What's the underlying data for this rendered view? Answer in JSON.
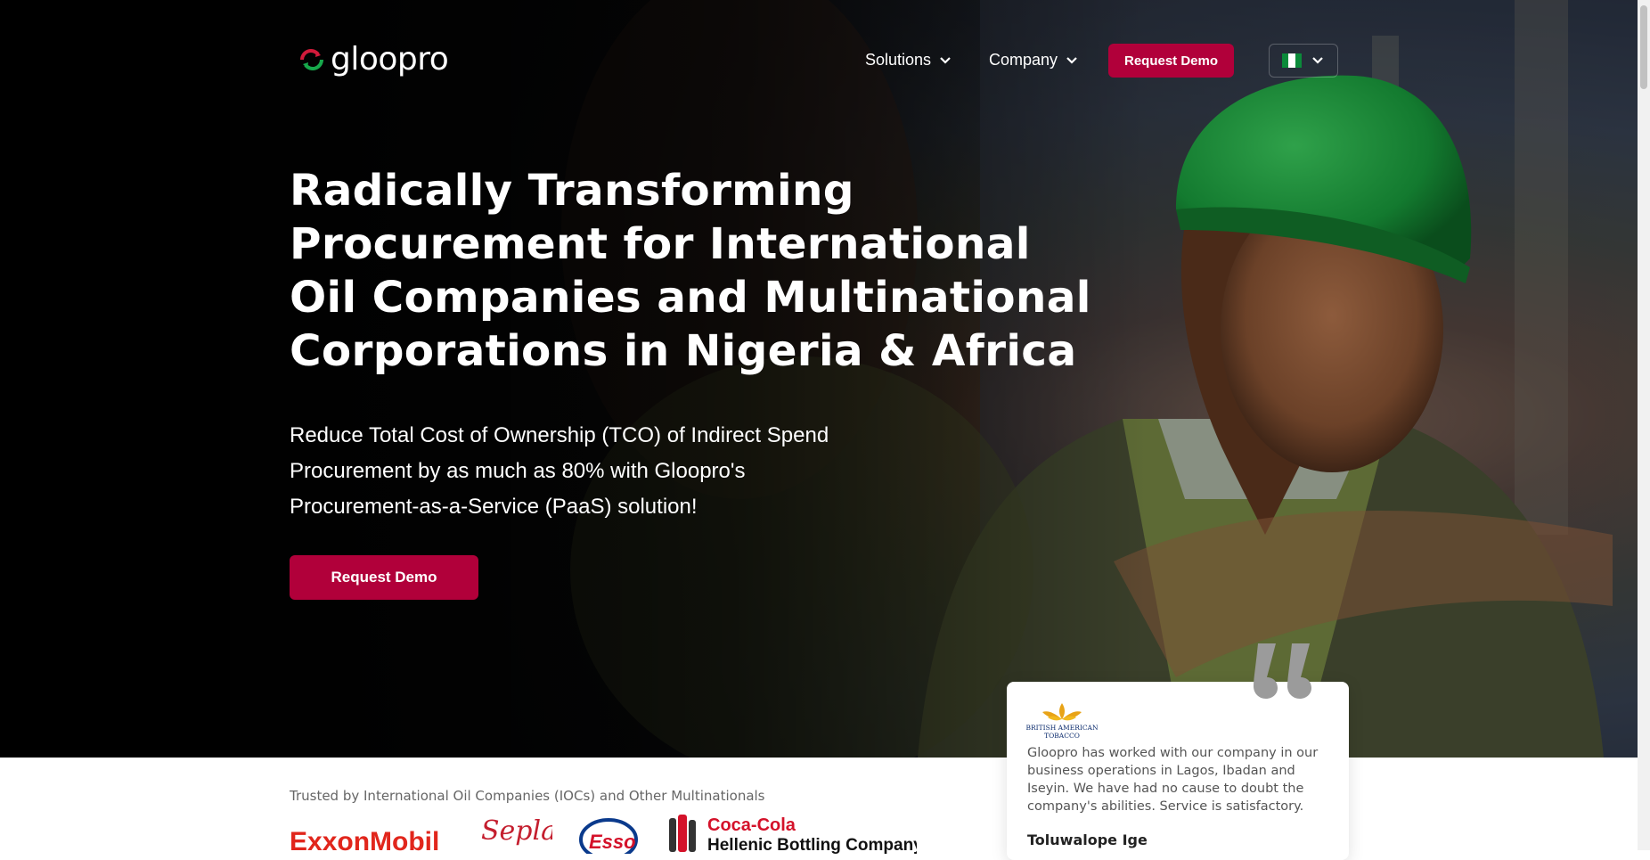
{
  "brand": {
    "name": "gloopro",
    "colors": {
      "accent": "#b1003a",
      "logo_green": "#17a84b",
      "logo_red": "#d11a3a"
    }
  },
  "nav": {
    "items": [
      {
        "label": "Solutions",
        "icon": "chevron-down-icon"
      },
      {
        "label": "Company",
        "icon": "chevron-down-icon"
      }
    ],
    "cta_label": "Request Demo",
    "language": {
      "flag": "nigeria-flag-icon",
      "icon": "chevron-down-icon"
    }
  },
  "hero": {
    "headline": "Radically Transforming Procurement for International Oil Companies and Multinational Corporations in Nigeria & Africa",
    "subtext": "Reduce Total Cost of Ownership (TCO) of Indirect Spend Procurement by as much as 80% with Gloopro's Procurement-as-a-Service (PaaS) solution!",
    "cta_label": "Request Demo"
  },
  "trusted": {
    "label": "Trusted by International Oil Companies (IOCs) and Other Multinationals",
    "logos": [
      "ExxonMobil",
      "Seplat",
      "Esso",
      "Coca-Cola",
      "Hellenic Bottling Company"
    ]
  },
  "testimonial": {
    "company_logo_text": [
      "BRITISH AMERICAN",
      "TOBACCO"
    ],
    "text": "Gloopro has worked with our company in our business operations in Lagos, Ibadan and Iseyin. We have had no cause to doubt the company's abilities. Service is satisfactory.",
    "author": "Toluwalope Ige"
  }
}
